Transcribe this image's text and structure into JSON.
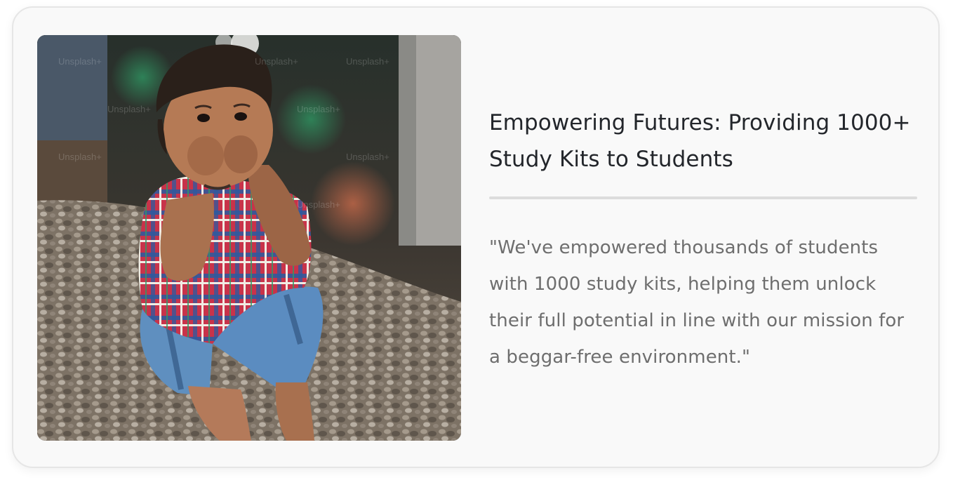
{
  "card": {
    "title": "Empowering Futures: Providing 1000+ Study Kits to Students",
    "quote": "\"We've empowered thousands of students with 1000 study kits, helping them unlock their full potential in line with our mission for a beggar-free environment.\""
  },
  "photo": {
    "watermark": "Unsplash+"
  }
}
